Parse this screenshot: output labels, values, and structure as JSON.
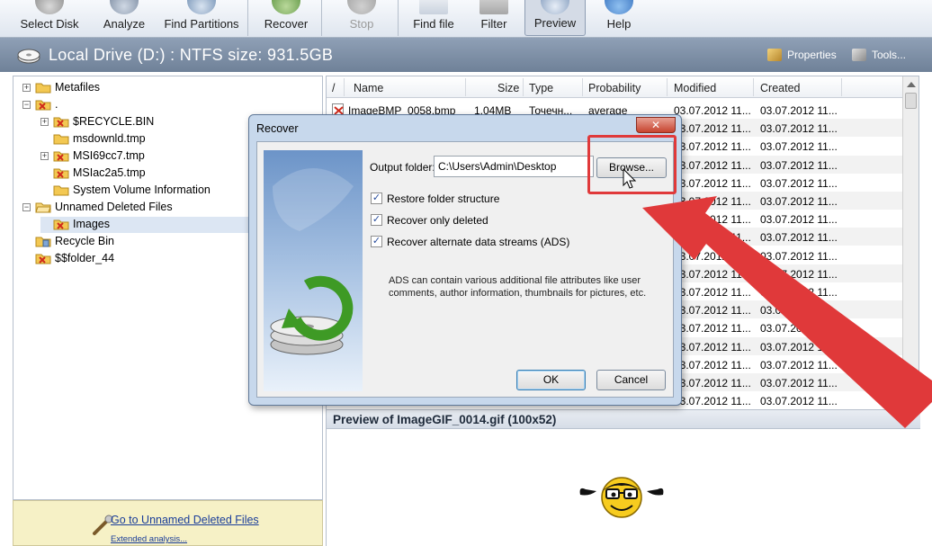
{
  "toolbar": {
    "buttons": [
      {
        "label": "Select Disk",
        "icon": "disk-icon"
      },
      {
        "label": "Analyze",
        "icon": "analyze-icon"
      },
      {
        "label": "Find Partitions",
        "icon": "partitions-icon"
      },
      {
        "label": "Recover",
        "icon": "recover-icon"
      },
      {
        "label": "Stop",
        "icon": "stop-icon",
        "disabled": true
      },
      {
        "label": "Find file",
        "icon": "find-file-icon"
      },
      {
        "label": "Filter",
        "icon": "filter-icon"
      },
      {
        "label": "Preview",
        "icon": "preview-eye-icon",
        "pressed": true
      },
      {
        "label": "Help",
        "icon": "help-icon"
      }
    ]
  },
  "drivebar": {
    "title": "Local Drive (D:) : NTFS size: 931.5GB",
    "properties_label": "Properties",
    "tools_label": "Tools..."
  },
  "tree": {
    "items": [
      {
        "label": "Metafiles",
        "icon": "folder-icon"
      },
      {
        "label": ".",
        "icon": "folder-deleted-icon"
      },
      {
        "label": "$RECYCLE.BIN",
        "icon": "folder-deleted-icon"
      },
      {
        "label": "msdownld.tmp",
        "icon": "folder-icon"
      },
      {
        "label": "MSI69cc7.tmp",
        "icon": "folder-deleted-icon"
      },
      {
        "label": "MSIac2a5.tmp",
        "icon": "folder-deleted-icon"
      },
      {
        "label": "System Volume Information",
        "icon": "folder-icon"
      },
      {
        "label": "Unnamed Deleted Files",
        "icon": "folder-open-icon"
      },
      {
        "label": "Images",
        "icon": "folder-deleted-icon"
      },
      {
        "label": "Recycle Bin",
        "icon": "recycle-bin-icon"
      },
      {
        "label": "$$folder_44",
        "icon": "folder-deleted-icon"
      }
    ]
  },
  "left_bottom": {
    "link": "Go to Unnamed Deleted Files",
    "small_link": "Extended analysis..."
  },
  "list": {
    "columns": [
      "/",
      "Name",
      "Size",
      "Type",
      "Probability",
      "Modified",
      "Created"
    ],
    "rows": [
      {
        "name": "ImageBMP_0058.bmp",
        "size": "1.04MB",
        "type": "Точечн...",
        "probability": "average",
        "modified": "03.07.2012 11...",
        "created": "03.07.2012 11..."
      },
      {
        "modified": "03.07.2012 11...",
        "created": "03.07.2012 11..."
      },
      {
        "modified": "03.07.2012 11...",
        "created": "03.07.2012 11..."
      },
      {
        "modified": "03.07.2012 11...",
        "created": "03.07.2012 11..."
      },
      {
        "modified": "03.07.2012 11...",
        "created": "03.07.2012 11..."
      },
      {
        "modified": "03.07.2012 11...",
        "created": "03.07.2012 11..."
      },
      {
        "modified": "03.07.2012 11...",
        "created": "03.07.2012 11..."
      },
      {
        "modified": "03.07.2012 11...",
        "created": "03.07.2012 11..."
      },
      {
        "modified": "03.07.2012 11...",
        "created": "03.07.2012 11..."
      },
      {
        "modified": "03.07.2012 11...",
        "created": "03.07.2012 11..."
      },
      {
        "modified": "03.07.2012 11...",
        "created": "03.07.2012 11..."
      },
      {
        "modified": "03.07.2012 11...",
        "created": "03.07.2012 11..."
      },
      {
        "modified": "03.07.2012 11...",
        "created": "03.07.2012 11..."
      },
      {
        "modified": "03.07.2012 11...",
        "created": "03.07.2012 11..."
      },
      {
        "modified": "03.07.2012 11...",
        "created": "03.07.2012 11..."
      },
      {
        "modified": "03.07.2012 11...",
        "created": "03.07.2012 11..."
      },
      {
        "modified": "03.07.2012 11...",
        "created": "03.07.2012 11..."
      }
    ]
  },
  "preview": {
    "title": "Preview of ImageGIF_0014.gif (100x52)"
  },
  "dialog": {
    "title": "Recover",
    "close_label": "✕",
    "output_folder_label": "Output folder:",
    "output_folder_value": "C:\\Users\\Admin\\Desktop",
    "browse_label": "Browse...",
    "options": [
      {
        "label": "Restore folder structure",
        "checked": true
      },
      {
        "label": "Recover only deleted",
        "checked": true
      },
      {
        "label": "Recover alternate data streams (ADS)",
        "checked": true
      }
    ],
    "ads_description": "ADS can contain various additional file attributes like user comments, author information, thumbnails for pictures, etc.",
    "ok_label": "OK",
    "cancel_label": "Cancel"
  },
  "colors": {
    "annotation_red": "#e0393a",
    "drivebar": "#7d8ea5",
    "dialog_frame": "#c7d8ec"
  }
}
